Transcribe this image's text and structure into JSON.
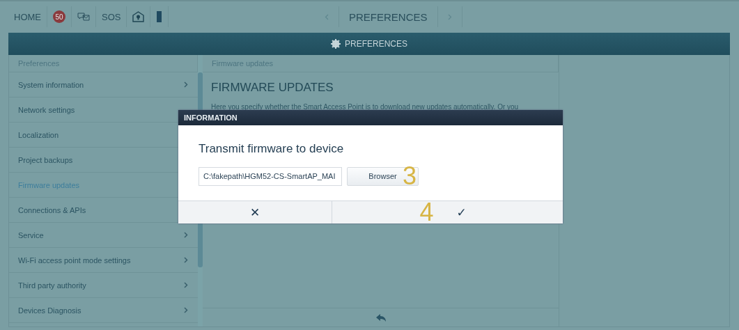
{
  "top_bar": {
    "home": "HOME",
    "badge": "50",
    "sos": "SOS",
    "nav_title": "PREFERENCES"
  },
  "header": {
    "title": "PREFERENCES"
  },
  "sidebar": {
    "heading": "Preferences",
    "items": [
      {
        "label": "System information",
        "selected": false,
        "arrow": true
      },
      {
        "label": "Network settings",
        "selected": false,
        "arrow": false
      },
      {
        "label": "Localization",
        "selected": false,
        "arrow": false
      },
      {
        "label": "Project backups",
        "selected": false,
        "arrow": false
      },
      {
        "label": "Firmware updates",
        "selected": true,
        "arrow": false
      },
      {
        "label": "Connections & APIs",
        "selected": false,
        "arrow": false
      },
      {
        "label": "Service",
        "selected": false,
        "arrow": true
      },
      {
        "label": "Wi-Fi access point mode settings",
        "selected": false,
        "arrow": true
      },
      {
        "label": "Third party authority",
        "selected": false,
        "arrow": true
      },
      {
        "label": "Devices Diagnosis",
        "selected": false,
        "arrow": true
      }
    ]
  },
  "content": {
    "heading": "Firmware updates",
    "title": "FIRMWARE UPDATES",
    "description": "Here you specify whether the Smart Access Point is to download new updates automatically. Or you"
  },
  "dialog": {
    "title": "INFORMATION",
    "heading": "Transmit firmware to device",
    "file_value": "C:\\fakepath\\HGM52-CS-SmartAP_MAI",
    "browse": "Browser",
    "cancel": "✕",
    "confirm": "✓",
    "annotations": [
      "3",
      "4"
    ]
  }
}
